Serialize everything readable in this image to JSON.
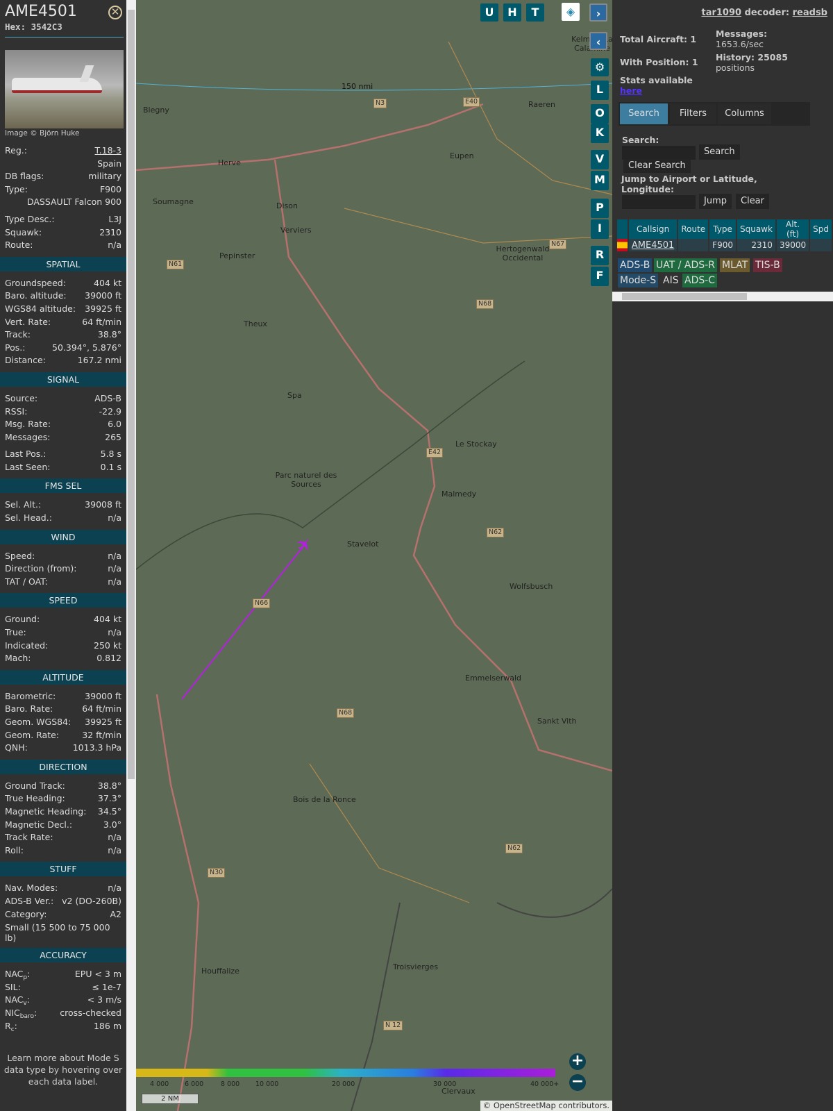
{
  "aircraft": {
    "callsign": "AME4501",
    "hex_label": "Hex:",
    "hex": "3542C3",
    "image_credit": "Image © Björn Huke"
  },
  "sections": [
    {
      "header": null,
      "rows": [
        [
          "Reg.:",
          "T.18-3"
        ],
        [
          "",
          "Spain"
        ],
        [
          "DB flags:",
          "military"
        ],
        [
          "Type:",
          "F900"
        ],
        [
          "",
          "DASSAULT Falcon 900"
        ],
        [
          "gap",
          ""
        ],
        [
          "Type Desc.:",
          "L3J"
        ],
        [
          "Squawk:",
          "2310"
        ],
        [
          "Route:",
          "n/a"
        ]
      ]
    },
    {
      "header": "SPATIAL",
      "rows": [
        [
          "Groundspeed:",
          "404 kt"
        ],
        [
          "Baro. altitude:",
          "39000 ft"
        ],
        [
          "WGS84 altitude:",
          "39925 ft"
        ],
        [
          "Vert. Rate:",
          "64 ft/min"
        ],
        [
          "Track:",
          "38.8°"
        ],
        [
          "Pos.:",
          "50.394°, 5.876°"
        ],
        [
          "Distance:",
          "167.2 nmi"
        ]
      ]
    },
    {
      "header": "SIGNAL",
      "rows": [
        [
          "Source:",
          "ADS-B"
        ],
        [
          "RSSI:",
          "-22.9"
        ],
        [
          "Msg. Rate:",
          "6.0"
        ],
        [
          "Messages:",
          "265"
        ],
        [
          "gap",
          ""
        ],
        [
          "Last Pos.:",
          "5.8 s"
        ],
        [
          "Last Seen:",
          "0.1 s"
        ]
      ]
    },
    {
      "header": "FMS SEL",
      "rows": [
        [
          "Sel. Alt.:",
          "39008 ft"
        ],
        [
          "Sel. Head.:",
          "n/a"
        ]
      ]
    },
    {
      "header": "WIND",
      "rows": [
        [
          "Speed:",
          "n/a"
        ],
        [
          "Direction (from):",
          "n/a"
        ],
        [
          "TAT / OAT:",
          "n/a"
        ]
      ]
    },
    {
      "header": "SPEED",
      "rows": [
        [
          "Ground:",
          "404 kt"
        ],
        [
          "True:",
          "n/a"
        ],
        [
          "Indicated:",
          "250 kt"
        ],
        [
          "Mach:",
          "0.812"
        ]
      ]
    },
    {
      "header": "ALTITUDE",
      "rows": [
        [
          "Barometric:",
          "39000 ft"
        ],
        [
          "Baro. Rate:",
          "64 ft/min"
        ],
        [
          "Geom. WGS84:",
          "39925 ft"
        ],
        [
          "Geom. Rate:",
          "32 ft/min"
        ],
        [
          "QNH:",
          "1013.3 hPa"
        ]
      ]
    },
    {
      "header": "DIRECTION",
      "rows": [
        [
          "Ground Track:",
          "38.8°"
        ],
        [
          "True Heading:",
          "37.3°"
        ],
        [
          "Magnetic Heading:",
          "34.5°"
        ],
        [
          "Magnetic Decl.:",
          "3.0°"
        ],
        [
          "Track Rate:",
          "n/a"
        ],
        [
          "Roll:",
          "n/a"
        ]
      ]
    },
    {
      "header": "STUFF",
      "rows": [
        [
          "Nav. Modes:",
          "n/a"
        ],
        [
          "ADS-B Ver.:",
          "v2 (DO-260B)"
        ],
        [
          "Category:",
          "A2"
        ],
        [
          "wrap",
          "Small (15 500 to 75 000 lb)"
        ]
      ]
    },
    {
      "header": "ACCURACY",
      "rows": [
        [
          "NACp:",
          "EPU < 3 m"
        ],
        [
          "SIL:",
          "≤ 1e-7"
        ],
        [
          "NACv:",
          "< 3 m/s"
        ],
        [
          "NICbaro:",
          "cross-checked"
        ],
        [
          "Rc:",
          "186 m"
        ]
      ]
    }
  ],
  "footer": "Learn more about Mode S data type by hovering over each data label.",
  "map": {
    "buttons_top": [
      "U",
      "H",
      "T"
    ],
    "buttons_side": [
      "L",
      "O",
      "K",
      "V",
      "M",
      "P",
      "I",
      "R",
      "F"
    ],
    "range_label": "150 nmi",
    "places": [
      [
        "Kelmis - La Calamine",
        612,
        50
      ],
      [
        "Blegny",
        10,
        152
      ],
      [
        "Raeren",
        565,
        144
      ],
      [
        "Herve",
        118,
        228
      ],
      [
        "Eupen",
        452,
        218
      ],
      [
        "Soumagne",
        24,
        284
      ],
      [
        "Dison",
        202,
        290
      ],
      [
        "Verviers",
        208,
        325
      ],
      [
        "Pepinster",
        120,
        362
      ],
      [
        "Hertogenwald Occidental",
        512,
        352
      ],
      [
        "Theux",
        155,
        460
      ],
      [
        "Spa",
        218,
        563
      ],
      [
        "Le Stockay",
        460,
        633
      ],
      [
        "Parc naturel des Sources",
        200,
        678
      ],
      [
        "Malmedy",
        440,
        705
      ],
      [
        "Stavelot",
        304,
        777
      ],
      [
        "Wolfsbusch",
        538,
        838
      ],
      [
        "Emmelserwald",
        474,
        970
      ],
      [
        "Sankt Vith",
        578,
        1032
      ],
      [
        "Bois de la Ronce",
        226,
        1145
      ],
      [
        "Houffalize",
        94,
        1392
      ],
      [
        "Troisvierges",
        370,
        1386
      ],
      [
        "Clervaux",
        440,
        1565
      ]
    ],
    "roads": [
      "N3",
      "E40",
      "N67",
      "N61",
      "N68",
      "E42",
      "N62",
      "N66",
      "N68",
      "N30",
      "N62",
      "N 12"
    ],
    "legend_ticks": [
      "4 000",
      "6 000",
      "8 000",
      "10 000",
      "20 000",
      "30 000",
      "40 000+"
    ],
    "scale": "2 NM",
    "attribution": "© OpenStreetMap contributors."
  },
  "right": {
    "tar1090": "tar1090",
    "decoder_label": "decoder:",
    "decoder": "readsb",
    "total_aircraft": "Total Aircraft: 1",
    "with_position": "With Position: 1",
    "messages_label": "Messages:",
    "messages": "1653.6/sec",
    "history_label": "History: 25085",
    "history_unit": "positions",
    "stats_label": "Stats available",
    "stats_link": "here",
    "tabs": [
      "Search",
      "Filters",
      "Columns"
    ],
    "search_label": "Search:",
    "search_btn": "Search",
    "clear_search_btn": "Clear Search",
    "jump_label": "Jump to Airport or Latitude, Longitude:",
    "jump_btn": "Jump",
    "clear_btn": "Clear",
    "table": {
      "headers": [
        "",
        "Callsign",
        "Route",
        "Type",
        "Squawk",
        "Alt. (ft)",
        "Spd"
      ],
      "rows": [
        [
          "",
          "AME4501",
          "",
          "F900",
          "2310",
          "39000",
          ""
        ]
      ]
    },
    "badges": [
      [
        "ADS-B",
        "#1f4a6e",
        "#ddd"
      ],
      [
        "UAT / ADS-R",
        "#1f6a3e",
        "#ddd"
      ],
      [
        "MLAT",
        "#6b5a2e",
        "#ddd"
      ],
      [
        "TIS-B",
        "#6b2a3a",
        "#ddd"
      ],
      [
        "Mode-S",
        "#254a66",
        "#ddd"
      ],
      [
        "AIS",
        "transparent",
        "#ddd"
      ],
      [
        "ADS-C",
        "#1f6a3e",
        "#ddd"
      ]
    ]
  },
  "colors": {
    "track": "#b520e0",
    "accent": "#00596b"
  }
}
